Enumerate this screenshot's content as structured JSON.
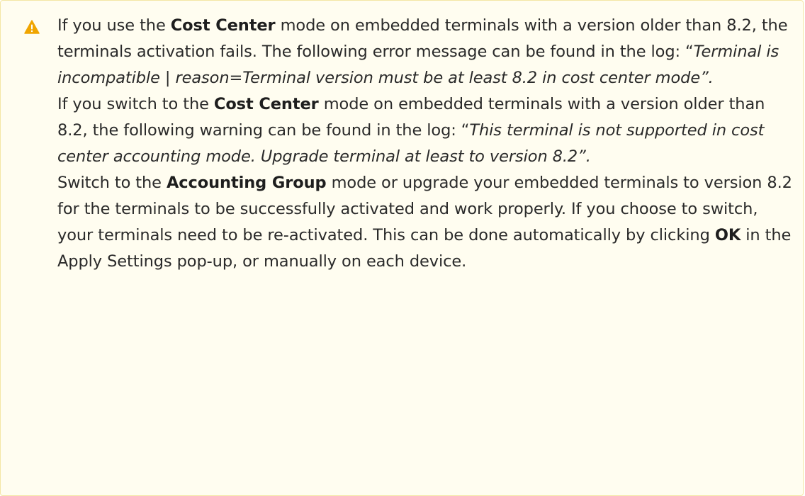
{
  "notice": {
    "icon": "warning-icon",
    "accent_color": "#f0a500",
    "background_color": "#fffdf0",
    "border_color": "#f4e6a5",
    "p1": {
      "a": "If you use the ",
      "b": "Cost Center",
      "c": " mode on embedded terminals with a version older than 8.2, the terminals activation fails. The following error message can be found in the log: “",
      "d": "Terminal is incompatible | reason=Terminal version must be at least 8.2 in cost center mode”."
    },
    "p2": {
      "a": "If you switch to the ",
      "b": "Cost Center",
      "c": " mode on embedded terminals with a version older than 8.2, the following warning can be found in the log: “",
      "d": "This terminal is not supported in cost center accounting mode. Upgrade terminal at least to version 8.2”."
    },
    "p3": {
      "a": "Switch to the ",
      "b": "Accounting Group",
      "c": " mode or upgrade your embedded terminals to version 8.2 for the terminals to be successfully activated and work properly. If you choose to switch, your terminals need to be re-activated. This can be done automatically by clicking ",
      "d": "OK",
      "e": " in the Apply Settings pop-up, or manually on each device."
    }
  }
}
